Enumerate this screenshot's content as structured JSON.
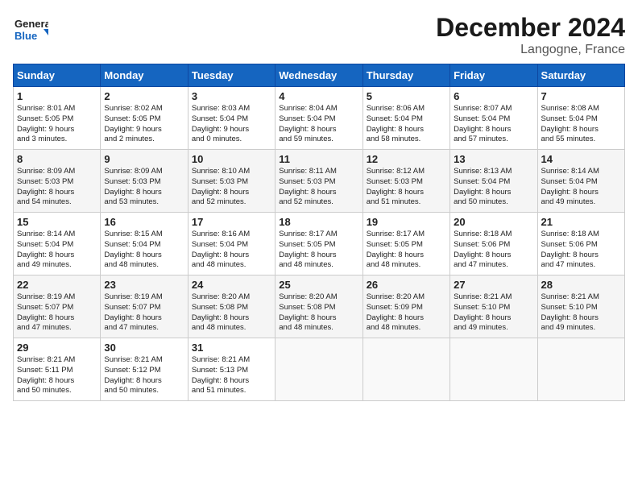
{
  "header": {
    "logo_line1": "General",
    "logo_line2": "Blue",
    "title": "December 2024",
    "subtitle": "Langogne, France"
  },
  "columns": [
    "Sunday",
    "Monday",
    "Tuesday",
    "Wednesday",
    "Thursday",
    "Friday",
    "Saturday"
  ],
  "weeks": [
    [
      {
        "day": "1",
        "text": "Sunrise: 8:01 AM\nSunset: 5:05 PM\nDaylight: 9 hours\nand 3 minutes."
      },
      {
        "day": "2",
        "text": "Sunrise: 8:02 AM\nSunset: 5:05 PM\nDaylight: 9 hours\nand 2 minutes."
      },
      {
        "day": "3",
        "text": "Sunrise: 8:03 AM\nSunset: 5:04 PM\nDaylight: 9 hours\nand 0 minutes."
      },
      {
        "day": "4",
        "text": "Sunrise: 8:04 AM\nSunset: 5:04 PM\nDaylight: 8 hours\nand 59 minutes."
      },
      {
        "day": "5",
        "text": "Sunrise: 8:06 AM\nSunset: 5:04 PM\nDaylight: 8 hours\nand 58 minutes."
      },
      {
        "day": "6",
        "text": "Sunrise: 8:07 AM\nSunset: 5:04 PM\nDaylight: 8 hours\nand 57 minutes."
      },
      {
        "day": "7",
        "text": "Sunrise: 8:08 AM\nSunset: 5:04 PM\nDaylight: 8 hours\nand 55 minutes."
      }
    ],
    [
      {
        "day": "8",
        "text": "Sunrise: 8:09 AM\nSunset: 5:03 PM\nDaylight: 8 hours\nand 54 minutes."
      },
      {
        "day": "9",
        "text": "Sunrise: 8:09 AM\nSunset: 5:03 PM\nDaylight: 8 hours\nand 53 minutes."
      },
      {
        "day": "10",
        "text": "Sunrise: 8:10 AM\nSunset: 5:03 PM\nDaylight: 8 hours\nand 52 minutes."
      },
      {
        "day": "11",
        "text": "Sunrise: 8:11 AM\nSunset: 5:03 PM\nDaylight: 8 hours\nand 52 minutes."
      },
      {
        "day": "12",
        "text": "Sunrise: 8:12 AM\nSunset: 5:03 PM\nDaylight: 8 hours\nand 51 minutes."
      },
      {
        "day": "13",
        "text": "Sunrise: 8:13 AM\nSunset: 5:04 PM\nDaylight: 8 hours\nand 50 minutes."
      },
      {
        "day": "14",
        "text": "Sunrise: 8:14 AM\nSunset: 5:04 PM\nDaylight: 8 hours\nand 49 minutes."
      }
    ],
    [
      {
        "day": "15",
        "text": "Sunrise: 8:14 AM\nSunset: 5:04 PM\nDaylight: 8 hours\nand 49 minutes."
      },
      {
        "day": "16",
        "text": "Sunrise: 8:15 AM\nSunset: 5:04 PM\nDaylight: 8 hours\nand 48 minutes."
      },
      {
        "day": "17",
        "text": "Sunrise: 8:16 AM\nSunset: 5:04 PM\nDaylight: 8 hours\nand 48 minutes."
      },
      {
        "day": "18",
        "text": "Sunrise: 8:17 AM\nSunset: 5:05 PM\nDaylight: 8 hours\nand 48 minutes."
      },
      {
        "day": "19",
        "text": "Sunrise: 8:17 AM\nSunset: 5:05 PM\nDaylight: 8 hours\nand 48 minutes."
      },
      {
        "day": "20",
        "text": "Sunrise: 8:18 AM\nSunset: 5:06 PM\nDaylight: 8 hours\nand 47 minutes."
      },
      {
        "day": "21",
        "text": "Sunrise: 8:18 AM\nSunset: 5:06 PM\nDaylight: 8 hours\nand 47 minutes."
      }
    ],
    [
      {
        "day": "22",
        "text": "Sunrise: 8:19 AM\nSunset: 5:07 PM\nDaylight: 8 hours\nand 47 minutes."
      },
      {
        "day": "23",
        "text": "Sunrise: 8:19 AM\nSunset: 5:07 PM\nDaylight: 8 hours\nand 47 minutes."
      },
      {
        "day": "24",
        "text": "Sunrise: 8:20 AM\nSunset: 5:08 PM\nDaylight: 8 hours\nand 48 minutes."
      },
      {
        "day": "25",
        "text": "Sunrise: 8:20 AM\nSunset: 5:08 PM\nDaylight: 8 hours\nand 48 minutes."
      },
      {
        "day": "26",
        "text": "Sunrise: 8:20 AM\nSunset: 5:09 PM\nDaylight: 8 hours\nand 48 minutes."
      },
      {
        "day": "27",
        "text": "Sunrise: 8:21 AM\nSunset: 5:10 PM\nDaylight: 8 hours\nand 49 minutes."
      },
      {
        "day": "28",
        "text": "Sunrise: 8:21 AM\nSunset: 5:10 PM\nDaylight: 8 hours\nand 49 minutes."
      }
    ],
    [
      {
        "day": "29",
        "text": "Sunrise: 8:21 AM\nSunset: 5:11 PM\nDaylight: 8 hours\nand 50 minutes."
      },
      {
        "day": "30",
        "text": "Sunrise: 8:21 AM\nSunset: 5:12 PM\nDaylight: 8 hours\nand 50 minutes."
      },
      {
        "day": "31",
        "text": "Sunrise: 8:21 AM\nSunset: 5:13 PM\nDaylight: 8 hours\nand 51 minutes."
      },
      {
        "day": "",
        "text": ""
      },
      {
        "day": "",
        "text": ""
      },
      {
        "day": "",
        "text": ""
      },
      {
        "day": "",
        "text": ""
      }
    ]
  ]
}
